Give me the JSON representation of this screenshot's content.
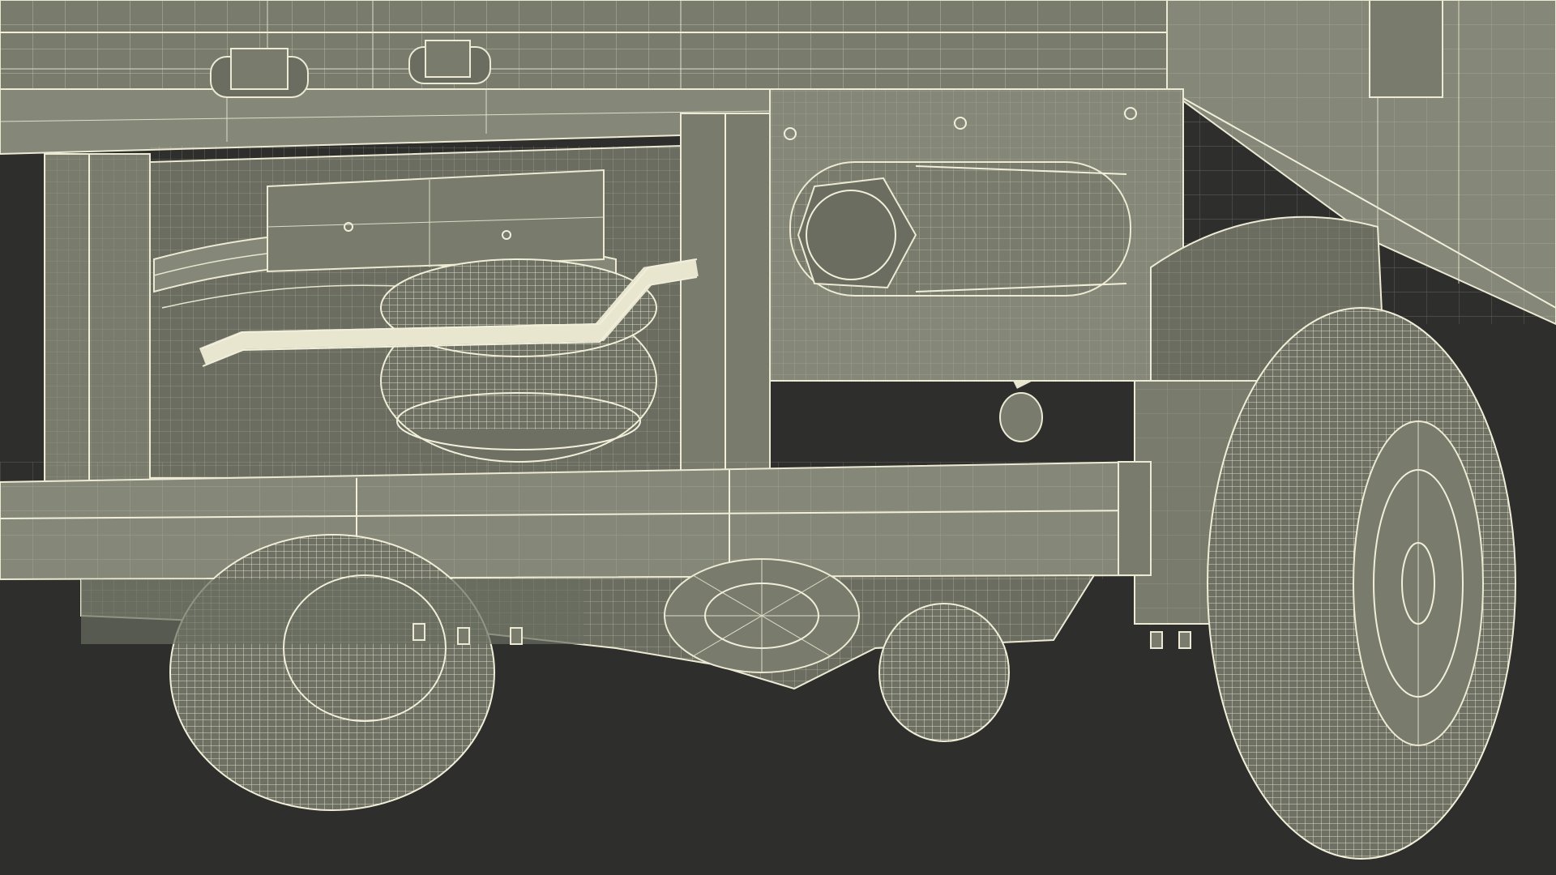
{
  "scene": {
    "subject": "truck-underside-wireframe",
    "colors": {
      "background": "#2e2e2c",
      "surface": "#797c6d",
      "surface_dark": "#6a6d60",
      "wire": "#e8e6cf"
    }
  }
}
